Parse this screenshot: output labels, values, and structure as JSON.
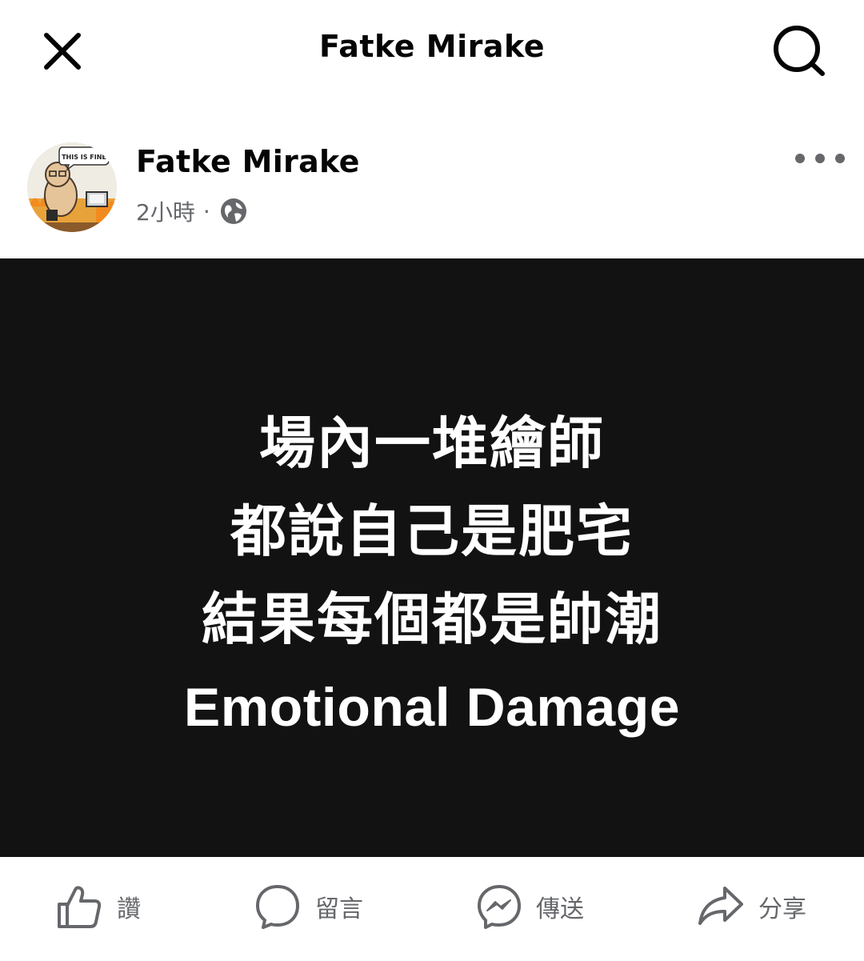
{
  "topbar": {
    "title": "Fatke Mirake",
    "close_icon": "close-icon",
    "search_icon": "search-icon"
  },
  "post": {
    "author": "Fatke Mirake",
    "time": "2小時",
    "separator": "·",
    "privacy_icon": "globe-icon",
    "more_icon": "more-horizontal-icon",
    "avatar_caption": "THIS IS FINE",
    "image": {
      "background": "#121212",
      "lines": [
        "場內一堆繪師",
        "都說自己是肥宅",
        "結果每個都是帥潮"
      ],
      "english_line": "Emotional Damage"
    }
  },
  "actions": [
    {
      "label": "讚",
      "icon": "thumbs-up-icon"
    },
    {
      "label": "留言",
      "icon": "comment-icon"
    },
    {
      "label": "傳送",
      "icon": "messenger-icon"
    },
    {
      "label": "分享",
      "icon": "share-icon"
    }
  ],
  "colors": {
    "text_primary": "#050505",
    "text_secondary": "#65676b",
    "icon": "#65676b"
  }
}
